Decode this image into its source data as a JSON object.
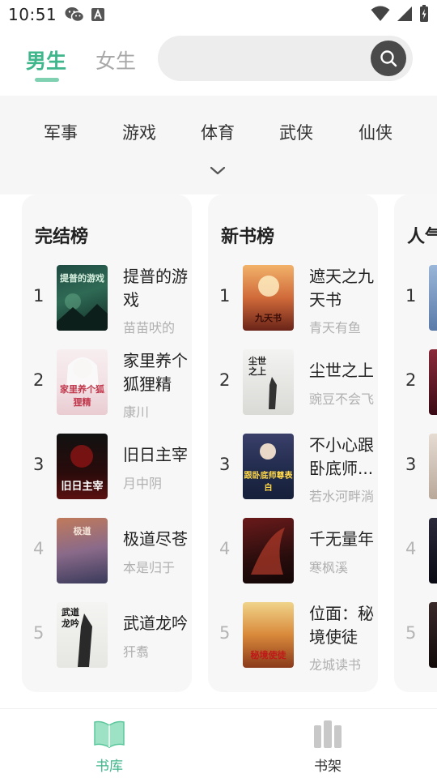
{
  "status_bar": {
    "time": "10:51"
  },
  "header": {
    "tabs": [
      {
        "label": "男生",
        "active": true
      },
      {
        "label": "女生",
        "active": false
      }
    ],
    "accent_color": "#3fb68b"
  },
  "categories": [
    "军事",
    "游戏",
    "体育",
    "武侠",
    "仙侠"
  ],
  "rankings": [
    {
      "title": "完结榜",
      "books": [
        {
          "rank": "1",
          "name": "提普的游戏",
          "author": "苗苗吠的",
          "cover_text": "提普的游戏"
        },
        {
          "rank": "2",
          "name": "家里养个狐狸精",
          "author": "康川",
          "cover_text": "家里养个狐狸精"
        },
        {
          "rank": "3",
          "name": "旧日主宰",
          "author": "月中阴",
          "cover_text": "旧日主宰"
        },
        {
          "rank": "4",
          "name": "极道尽苍",
          "author": "本是归于",
          "cover_text": "极道"
        },
        {
          "rank": "5",
          "name": "武道龙吟",
          "author": "犴翥",
          "cover_text": "武道龙吟"
        }
      ]
    },
    {
      "title": "新书榜",
      "books": [
        {
          "rank": "1",
          "name": "遮天之九天书",
          "author": "青天有鱼",
          "cover_text": "九天书"
        },
        {
          "rank": "2",
          "name": "尘世之上",
          "author": "豌豆不会飞",
          "cover_text": "尘世之上"
        },
        {
          "rank": "3",
          "name": "不小心跟卧底师...",
          "author": "若水河畔淌",
          "cover_text": "跟卧底师尊表白"
        },
        {
          "rank": "4",
          "name": "千无量年",
          "author": "寒枫溪",
          "cover_text": ""
        },
        {
          "rank": "5",
          "name": "位面：秘境使徒",
          "author": "龙城读书",
          "cover_text": "秘境使徒"
        }
      ]
    },
    {
      "title": "人气",
      "books": [
        {
          "rank": "1"
        },
        {
          "rank": "2"
        },
        {
          "rank": "3"
        },
        {
          "rank": "4"
        },
        {
          "rank": "5"
        }
      ]
    }
  ],
  "bottom_nav": [
    {
      "label": "书库",
      "icon": "open-book-icon",
      "active": true
    },
    {
      "label": "书架",
      "icon": "bookshelf-icon",
      "active": false
    }
  ]
}
